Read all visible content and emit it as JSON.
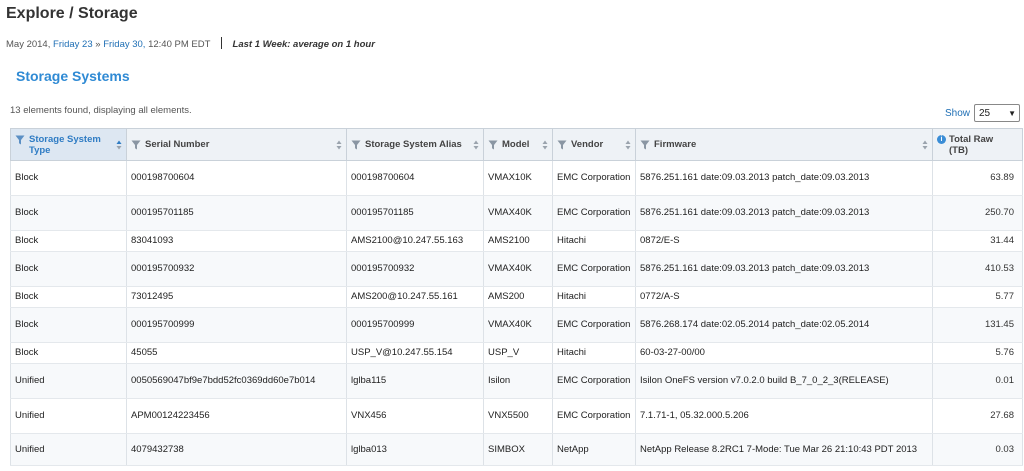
{
  "page": {
    "title": "Explore / Storage"
  },
  "date_line": {
    "month_year": "May 2014,",
    "from": "Friday 23",
    "arrow": "»",
    "to": "Friday 30,",
    "time": "12:40 PM EDT",
    "range": "Last 1 Week: average on 1 hour"
  },
  "section": {
    "title": "Storage Systems",
    "found_text": "13 elements found, displaying all elements."
  },
  "show": {
    "label": "Show",
    "value": "25"
  },
  "colors": {
    "accent": "#2f8ad4",
    "link": "#1f6fb5"
  },
  "table": {
    "columns": [
      {
        "label": "Storage System Type",
        "icon": "filter-icon",
        "sorted": true
      },
      {
        "label": "Serial Number",
        "icon": "filter-icon",
        "sorted": false
      },
      {
        "label": "Storage System Alias",
        "icon": "filter-icon",
        "sorted": false
      },
      {
        "label": "Model",
        "icon": "filter-icon",
        "sorted": false
      },
      {
        "label": "Vendor",
        "icon": "filter-icon",
        "sorted": false
      },
      {
        "label": "Firmware",
        "icon": "filter-icon",
        "sorted": false
      },
      {
        "label": "Total Raw (TB)",
        "icon": "info-icon",
        "sorted": false
      }
    ],
    "rows": [
      {
        "type": "Block",
        "serial": "000198700604",
        "alias": "000198700604",
        "model": "VMAX10K",
        "vendor": "EMC Corporation",
        "firmware": "5876.251.161 date:09.03.2013 patch_date:09.03.2013",
        "total_raw": "63.89"
      },
      {
        "type": "Block",
        "serial": "000195701185",
        "alias": "000195701185",
        "model": "VMAX40K",
        "vendor": "EMC Corporation",
        "firmware": "5876.251.161 date:09.03.2013 patch_date:09.03.2013",
        "total_raw": "250.70"
      },
      {
        "type": "Block",
        "serial": "83041093",
        "alias": "AMS2100@10.247.55.163",
        "model": "AMS2100",
        "vendor": "Hitachi",
        "firmware": "0872/E-S",
        "total_raw": "31.44"
      },
      {
        "type": "Block",
        "serial": "000195700932",
        "alias": "000195700932",
        "model": "VMAX40K",
        "vendor": "EMC Corporation",
        "firmware": "5876.251.161 date:09.03.2013 patch_date:09.03.2013",
        "total_raw": "410.53"
      },
      {
        "type": "Block",
        "serial": "73012495",
        "alias": "AMS200@10.247.55.161",
        "model": "AMS200",
        "vendor": "Hitachi",
        "firmware": "0772/A-S",
        "total_raw": "5.77"
      },
      {
        "type": "Block",
        "serial": "000195700999",
        "alias": "000195700999",
        "model": "VMAX40K",
        "vendor": "EMC Corporation",
        "firmware": "5876.268.174 date:02.05.2014 patch_date:02.05.2014",
        "total_raw": "131.45"
      },
      {
        "type": "Block",
        "serial": "45055",
        "alias": "USP_V@10.247.55.154",
        "model": "USP_V",
        "vendor": "Hitachi",
        "firmware": "60-03-27-00/00",
        "total_raw": "5.76"
      },
      {
        "type": "Unified",
        "serial": "0050569047bf9e7bdd52fc0369dd60e7b014",
        "alias": "lglba115",
        "model": "Isilon",
        "vendor": "EMC Corporation",
        "firmware": "Isilon OneFS version v7.0.2.0 build B_7_0_2_3(RELEASE)",
        "total_raw": "0.01"
      },
      {
        "type": "Unified",
        "serial": "APM00124223456",
        "alias": "VNX456",
        "model": "VNX5500",
        "vendor": "EMC Corporation",
        "firmware": "7.1.71-1, 05.32.000.5.206",
        "total_raw": "27.68"
      },
      {
        "type": "Unified",
        "serial": "4079432738",
        "alias": "lglba013",
        "model": "SIMBOX",
        "vendor": "NetApp",
        "firmware": "NetApp Release 8.2RC1 7-Mode: Tue Mar 26 21:10:43 PDT 2013",
        "total_raw": "0.03"
      }
    ]
  }
}
